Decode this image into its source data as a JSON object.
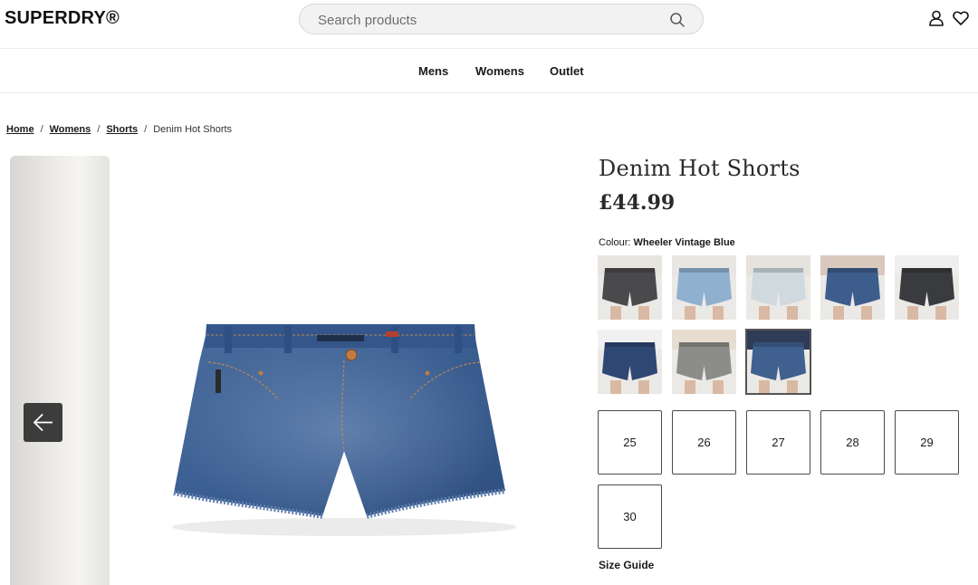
{
  "header": {
    "logo": "SUPERDRY®",
    "search_placeholder": "Search products"
  },
  "nav": {
    "items": [
      "Mens",
      "Womens",
      "Outlet"
    ]
  },
  "breadcrumb": {
    "home": "Home",
    "womens": "Womens",
    "shorts": "Shorts",
    "current": "Denim Hot Shorts",
    "separator": "/"
  },
  "product": {
    "title": "Denim Hot Shorts",
    "price": "£44.99",
    "colour_label": "Colour:",
    "colour_value": "Wheeler Vintage Blue"
  },
  "swatches": [
    {
      "label": "black acid wash",
      "denim": "#4a4a4c",
      "top": "#e8e4df"
    },
    {
      "label": "light blue",
      "denim": "#8fb0cf",
      "top": "#e9e6e2"
    },
    {
      "label": "bleached white",
      "denim": "#cfd9de",
      "top": "#e6e2dc"
    },
    {
      "label": "mid blue",
      "denim": "#3d5d8d",
      "top": "#d9c8bd"
    },
    {
      "label": "charcoal",
      "denim": "#3a3b3e",
      "top": "#eeeeee"
    },
    {
      "label": "dark indigo",
      "denim": "#2f4773",
      "top": "#f1f1f1"
    },
    {
      "label": "grey wash",
      "denim": "#8c8c8a",
      "top": "#e7ddd0"
    },
    {
      "label": "Wheeler Vintage Blue",
      "denim": "#40618f",
      "top": "#2f3b57",
      "selected": true
    }
  ],
  "sizes": [
    "25",
    "26",
    "27",
    "28",
    "29",
    "30"
  ],
  "size_guide": "Size Guide",
  "icons": {
    "search": "search-icon",
    "account": "user-icon",
    "wishlist": "heart-icon",
    "prev": "arrow-left-icon"
  }
}
